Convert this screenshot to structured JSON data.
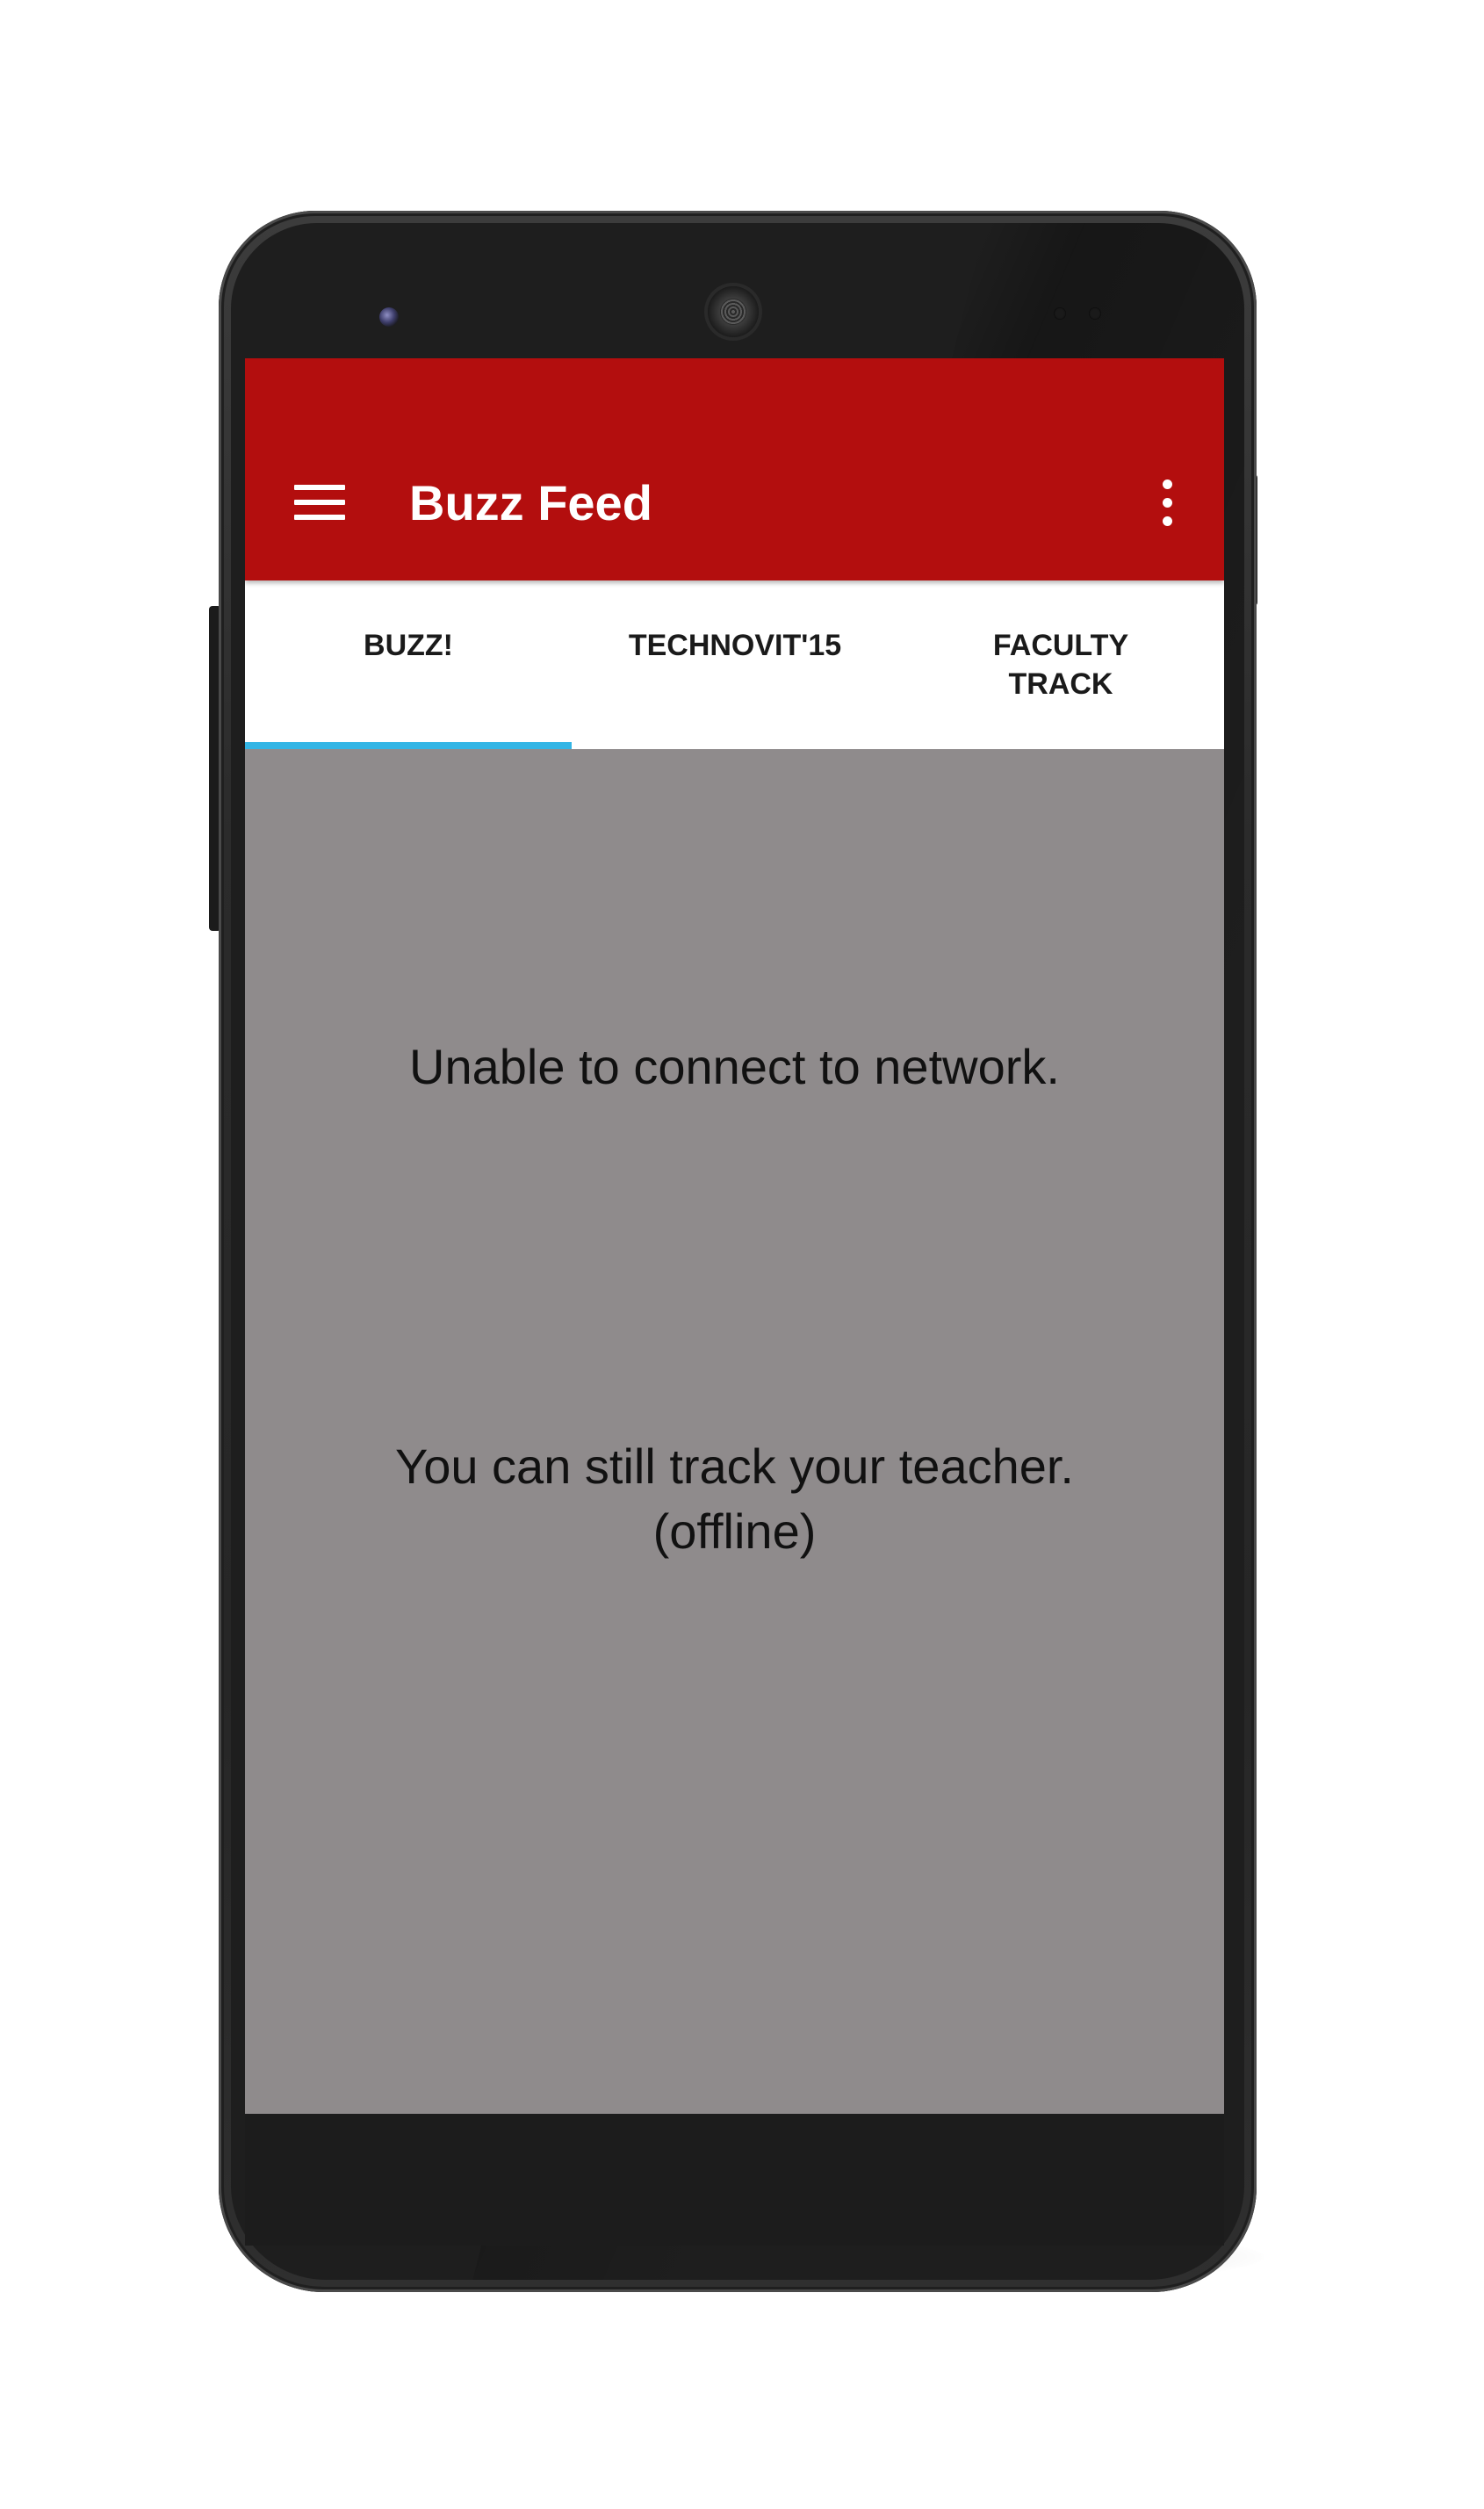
{
  "app_bar": {
    "title": "Buzz Feed",
    "background_color": "#b30e0e",
    "menu_icon": "hamburger-menu-icon",
    "overflow_icon": "more-vert-icon"
  },
  "tabs": [
    {
      "label": "BUZZ!",
      "selected": true
    },
    {
      "label": "TECHNOVIT'15",
      "selected": false
    },
    {
      "label": "FACULTY\nTRACK",
      "selected": false
    }
  ],
  "tab_indicator_color": "#33b5e5",
  "content": {
    "background_color": "#8f8b8c",
    "network_error": "Unable to connect to network.",
    "offline_hint": "You can still track your teacher.\n(offline)"
  }
}
